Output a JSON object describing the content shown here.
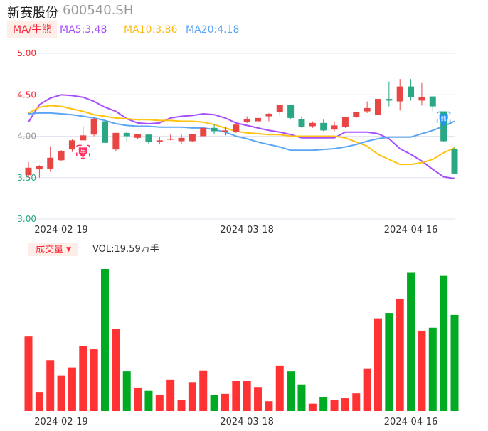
{
  "header": {
    "name": "新赛股份",
    "code": "600540.SH"
  },
  "legend": {
    "ma_tag": "MA/牛熊",
    "ma5": "MA5:3.48",
    "ma10": "MA10:3.86",
    "ma20": "MA20:4.18"
  },
  "volume_panel": {
    "tag": "成交量",
    "tag_icon": "caret-down-icon",
    "vol": "VOL:19.59万手"
  },
  "colors": {
    "up": "#e84545",
    "down": "#2aa784",
    "vol_up": "#ff3333",
    "vol_down": "#00aa22",
    "ma5": "#a64dff",
    "ma10": "#ffc20e",
    "ma20": "#5aa6f5",
    "grid": "#e3e6f0"
  },
  "markers": [
    {
      "index": 5,
      "label": "牛",
      "color": "#ff3366"
    },
    {
      "index": 38,
      "label": "熊",
      "color": "#1e90ff"
    }
  ],
  "chart_data": [
    {
      "type": "candlestick",
      "y_ticks": [
        "5.00",
        "4.50",
        "4.00",
        "3.50",
        "3.00"
      ],
      "ylim": [
        3.0,
        5.0
      ],
      "grid": true,
      "x_ticks": [
        {
          "index": 3,
          "label": "2024-02-19"
        },
        {
          "index": 20,
          "label": "2024-03-18"
        },
        {
          "index": 35,
          "label": "2024-04-16"
        }
      ],
      "ohlc": [
        [
          3.53,
          3.62,
          3.69,
          3.5
        ],
        [
          3.6,
          3.64,
          3.65,
          3.5
        ],
        [
          3.61,
          3.74,
          3.88,
          3.57
        ],
        [
          3.71,
          3.82,
          3.83,
          3.7
        ],
        [
          3.84,
          3.95,
          3.96,
          3.81
        ],
        [
          3.95,
          4.01,
          4.12,
          3.95
        ],
        [
          4.02,
          4.21,
          4.22,
          4.0
        ],
        [
          4.18,
          3.92,
          4.27,
          3.88
        ],
        [
          3.84,
          4.04,
          4.04,
          3.82
        ],
        [
          4.04,
          4.0,
          4.06,
          3.94
        ],
        [
          3.98,
          4.03,
          4.03,
          3.97
        ],
        [
          4.02,
          3.93,
          4.02,
          3.91
        ],
        [
          3.93,
          3.95,
          3.99,
          3.9
        ],
        [
          3.96,
          3.97,
          4.02,
          3.95
        ],
        [
          3.94,
          3.98,
          4.02,
          3.91
        ],
        [
          3.94,
          4.03,
          4.03,
          3.93
        ],
        [
          4.0,
          4.1,
          4.1,
          4.0
        ],
        [
          4.1,
          4.06,
          4.15,
          4.03
        ],
        [
          4.05,
          4.07,
          4.11,
          4.01
        ],
        [
          4.05,
          4.14,
          4.15,
          4.04
        ],
        [
          4.17,
          4.21,
          4.24,
          4.16
        ],
        [
          4.18,
          4.22,
          4.31,
          4.16
        ],
        [
          4.24,
          4.27,
          4.28,
          4.18
        ],
        [
          4.29,
          4.38,
          4.38,
          4.25
        ],
        [
          4.38,
          4.22,
          4.38,
          4.21
        ],
        [
          4.21,
          4.11,
          4.24,
          4.1
        ],
        [
          4.12,
          4.16,
          4.18,
          4.1
        ],
        [
          4.16,
          4.07,
          4.2,
          4.06
        ],
        [
          4.08,
          4.13,
          4.18,
          4.06
        ],
        [
          4.11,
          4.23,
          4.23,
          4.1
        ],
        [
          4.23,
          4.29,
          4.29,
          4.22
        ],
        [
          4.3,
          4.34,
          4.42,
          4.28
        ],
        [
          4.26,
          4.45,
          4.52,
          4.24
        ],
        [
          4.45,
          4.43,
          4.66,
          4.36
        ],
        [
          4.42,
          4.6,
          4.69,
          4.31
        ],
        [
          4.6,
          4.47,
          4.69,
          4.43
        ],
        [
          4.43,
          4.47,
          4.65,
          4.37
        ],
        [
          4.48,
          4.36,
          4.48,
          4.3
        ],
        [
          4.3,
          3.94,
          4.3,
          3.93
        ],
        [
          3.85,
          3.55,
          3.87,
          3.54
        ]
      ],
      "series": [
        {
          "name": "MA5",
          "values": [
            4.17,
            4.38,
            4.46,
            4.5,
            4.49,
            4.47,
            4.42,
            4.35,
            4.3,
            4.21,
            4.16,
            4.15,
            4.16,
            4.22,
            4.24,
            4.25,
            4.27,
            4.26,
            4.22,
            4.16,
            4.13,
            4.1,
            4.07,
            4.05,
            4.02,
            3.98,
            3.98,
            3.98,
            3.98,
            4.05,
            4.05,
            4.05,
            4.03,
            3.97,
            3.85,
            3.78,
            3.7,
            3.6,
            3.51,
            3.49
          ]
        },
        {
          "name": "MA10",
          "values": [
            4.28,
            4.35,
            4.37,
            4.36,
            4.33,
            4.3,
            4.26,
            4.24,
            4.22,
            4.21,
            4.2,
            4.2,
            4.19,
            4.19,
            4.18,
            4.18,
            4.17,
            4.14,
            4.1,
            4.06,
            4.04,
            4.03,
            4.02,
            4.02,
            4.0,
            4.0,
            4.0,
            4.0,
            4.0,
            3.98,
            3.93,
            3.88,
            3.78,
            3.72,
            3.66,
            3.66,
            3.68,
            3.72,
            3.8,
            3.86
          ]
        },
        {
          "name": "MA20",
          "values": [
            4.27,
            4.28,
            4.28,
            4.27,
            4.26,
            4.24,
            4.22,
            4.19,
            4.15,
            4.13,
            4.12,
            4.12,
            4.11,
            4.11,
            4.11,
            4.1,
            4.1,
            4.08,
            4.05,
            4.0,
            3.97,
            3.93,
            3.9,
            3.87,
            3.83,
            3.83,
            3.83,
            3.84,
            3.85,
            3.87,
            3.9,
            3.94,
            3.97,
            3.99,
            3.99,
            3.99,
            4.03,
            4.07,
            4.12,
            4.18
          ]
        }
      ]
    },
    {
      "type": "bar",
      "unit": "万手",
      "values": [
        15.2,
        3.9,
        10.4,
        7.3,
        8.9,
        13.2,
        12.6,
        29.0,
        16.7,
        8.1,
        4.8,
        4.1,
        3.2,
        6.4,
        2.3,
        5.9,
        8.3,
        3.2,
        3.5,
        6.1,
        6.2,
        4.9,
        2.0,
        9.3,
        8.1,
        5.4,
        1.5,
        2.9,
        2.3,
        2.6,
        3.6,
        8.6,
        18.9,
        20.0,
        22.8,
        28.2,
        16.4,
        17.0,
        27.6,
        19.59
      ],
      "x_ticks": [
        {
          "index": 3,
          "label": "2024-02-19"
        },
        {
          "index": 20,
          "label": "2024-03-18"
        },
        {
          "index": 35,
          "label": "2024-04-16"
        }
      ]
    }
  ]
}
